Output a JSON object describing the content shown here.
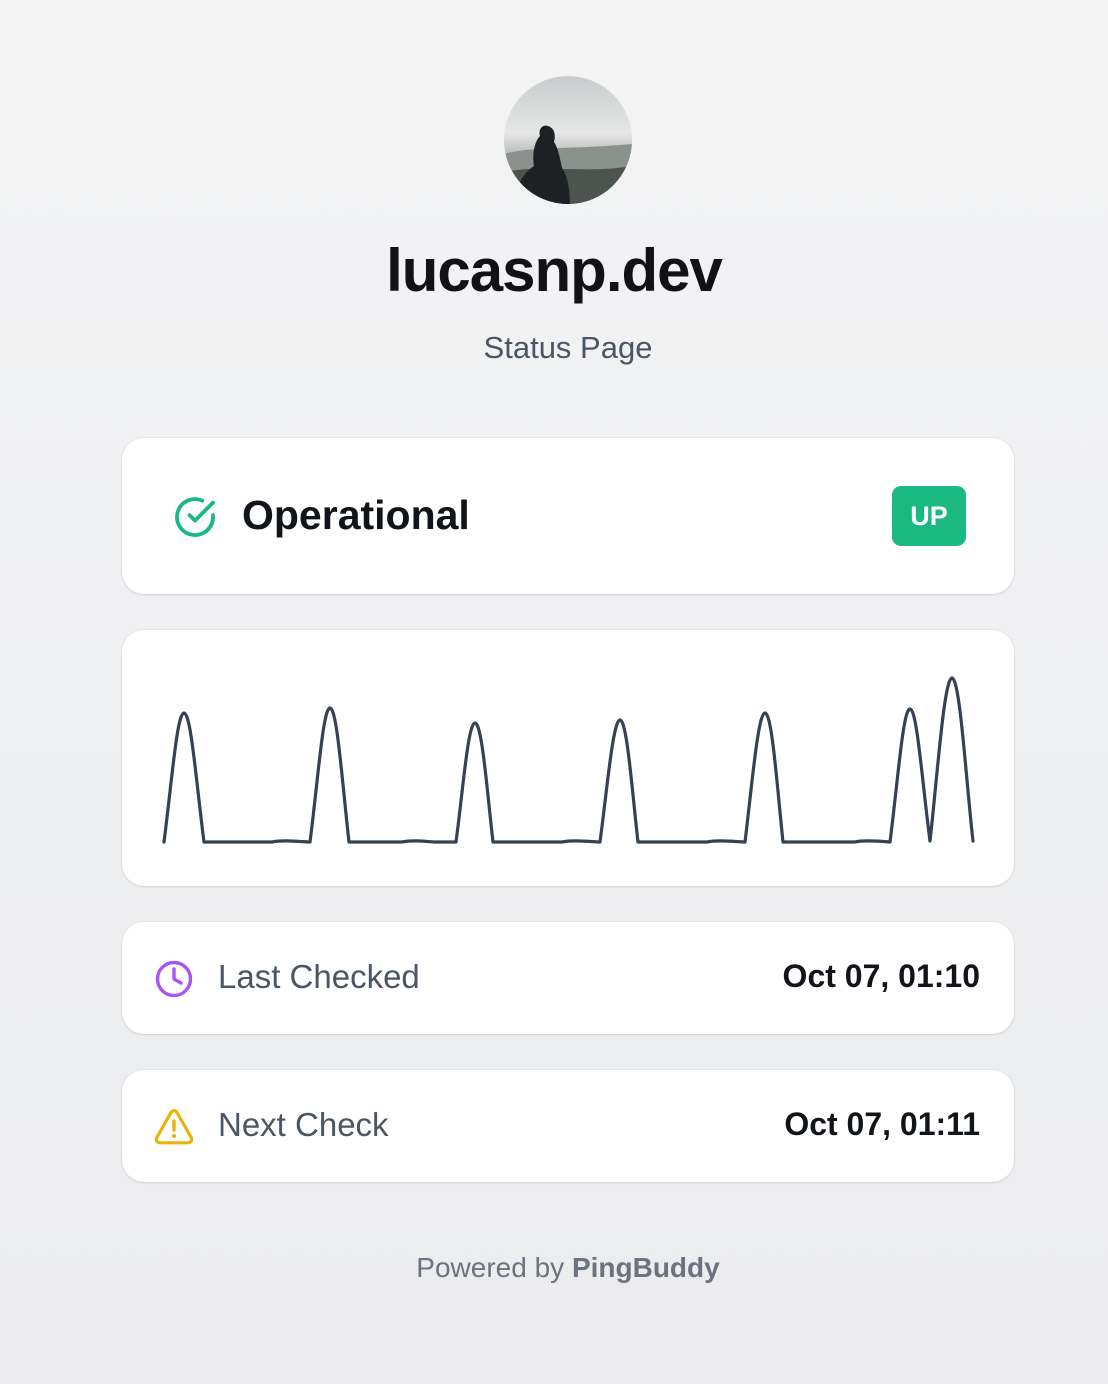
{
  "header": {
    "title": "lucasnp.dev",
    "subtitle": "Status Page"
  },
  "status": {
    "label": "Operational",
    "badge": "UP",
    "icon": "check-circle-icon",
    "color": "#19b981"
  },
  "chart_data": {
    "type": "line",
    "x": [
      0,
      1,
      2,
      3,
      4,
      5,
      6,
      7,
      8,
      9,
      10,
      11,
      12,
      13,
      14,
      15,
      16,
      17,
      18,
      19,
      20,
      21,
      22,
      23,
      24,
      25,
      26,
      27,
      28,
      29,
      30,
      31,
      32,
      33,
      34,
      35,
      36,
      37,
      38,
      39,
      40,
      41,
      42,
      43,
      44,
      45,
      46,
      47,
      48,
      49,
      50,
      51,
      52,
      53,
      54,
      55,
      56,
      57,
      58,
      59,
      60,
      61,
      62,
      63,
      64,
      65,
      66,
      67,
      68,
      69,
      70,
      71,
      72,
      73,
      74,
      75,
      76,
      77,
      78,
      79,
      80,
      81,
      82,
      83,
      84,
      85,
      86,
      87,
      88,
      89,
      90,
      91,
      92,
      93,
      94,
      95,
      96,
      97,
      98,
      99,
      100
    ],
    "values": [
      0,
      0,
      0,
      0,
      0,
      0,
      0,
      0,
      0,
      0,
      0,
      0,
      0,
      0,
      0,
      0,
      0,
      0,
      0,
      0,
      0,
      0,
      0,
      0,
      0,
      0,
      0,
      0,
      0,
      0,
      0,
      0,
      0,
      0,
      0,
      0,
      0,
      0,
      0,
      0,
      0,
      0,
      0,
      0,
      0,
      0,
      0,
      0,
      0,
      0,
      0,
      0,
      0,
      0,
      0,
      0,
      0,
      0,
      0,
      0,
      0,
      0,
      0,
      0,
      0,
      0,
      0,
      0,
      0,
      0,
      0,
      0,
      0,
      0,
      0,
      0,
      0,
      0,
      0,
      0,
      0,
      0,
      0,
      0,
      0,
      0,
      0,
      0,
      0,
      0,
      0,
      0,
      0,
      0,
      0,
      0,
      0,
      0,
      0,
      0,
      0
    ],
    "color": "#374151"
  },
  "last_checked": {
    "label": "Last Checked",
    "value": "Oct 07, 01:10",
    "icon": "clock-icon",
    "color": "#a855f7"
  },
  "next_check": {
    "label": "Next Check",
    "value": "Oct 07, 01:11",
    "icon": "warning-icon",
    "color": "#eab308"
  },
  "footer": {
    "prefix": "Powered by ",
    "brand": "PingBuddy"
  }
}
